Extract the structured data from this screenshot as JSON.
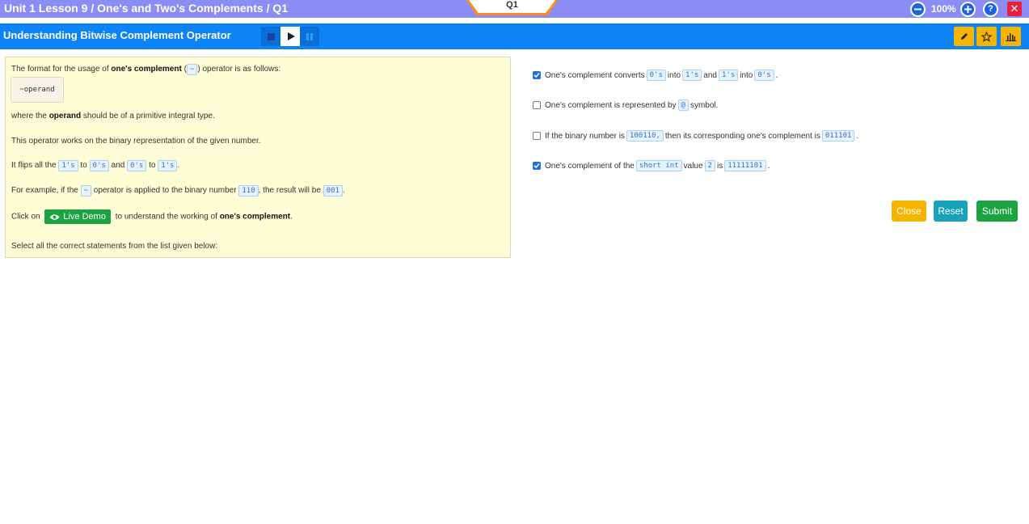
{
  "header": {
    "breadcrumb": "Unit 1 Lesson 9 / One's and Two's Complements / Q1",
    "question_tab": "Q1",
    "zoom": "100%",
    "zoom_out_icon": "minus-circle-icon",
    "zoom_in_icon": "plus-circle-icon",
    "help_icon": "question-circle-icon",
    "close_icon": "close-icon",
    "colors": {
      "header_bg": "#8c8cf5",
      "tab_accent": "#ff8c1a",
      "close_bg": "#e8223c"
    }
  },
  "toolbar": {
    "title": "Understanding Bitwise Complement Operator",
    "media_icons": [
      "stop-icon",
      "play-icon",
      "pause-icon"
    ],
    "tool_icons": [
      "pencil-icon",
      "star-icon",
      "bar-chart-icon"
    ],
    "colors": {
      "bar_bg": "#0d84f5",
      "tool_bg": "#f5b400"
    }
  },
  "lesson": {
    "l1_pre": "The format for the usage of ",
    "l1_bold": "one's complement",
    "l1_mid": " (",
    "l1_code": "~",
    "l1_post": ") operator is as follows:",
    "code_sample": "~operand",
    "l2_pre": "where the ",
    "l2_bold": "operand",
    "l2_post": " should be of a primitive integral type.",
    "l3": "This operator works on the binary representation of the given number.",
    "l4_a": "It flips all the ",
    "l4_c1": "1's",
    "l4_b": " to ",
    "l4_c2": "0's",
    "l4_c": " and ",
    "l4_c3": "0's",
    "l4_d": " to ",
    "l4_c4": "1's",
    "l4_e": ".",
    "l5_a": "For example, if the ",
    "l5_c1": "~",
    "l5_b": " operator is applied to the binary number ",
    "l5_c2": "110",
    "l5_c": ", the result will be ",
    "l5_c3": "001",
    "l5_d": ".",
    "l6_a": "Click on ",
    "live_demo": "Live Demo",
    "live_demo_icon": "eye-icon",
    "l6_b": " to understand the working of ",
    "l6_bold": "one's complement",
    "l6_c": ".",
    "l7": "Select all the correct statements from the list given below:"
  },
  "options": [
    {
      "checked": true,
      "t1": "One's complement converts ",
      "c1": "0's",
      "t2": " into ",
      "c2": "1's",
      "t3": " and ",
      "c3": "1's",
      "t4": " into ",
      "c4": "0's",
      "t5": "."
    },
    {
      "checked": false,
      "t1": "One's complement is represented by ",
      "c1": "@",
      "t2": " symbol."
    },
    {
      "checked": false,
      "t1": "If the binary number is ",
      "c1": "100110,",
      "t2": " then its corresponding one's complement is ",
      "c2": "011101",
      "t3": "."
    },
    {
      "checked": true,
      "t1": "One's complement of the ",
      "c1": "short int",
      "t2": " value ",
      "c2": "2",
      "t3": " is ",
      "c3": "11111101",
      "t4": "."
    }
  ],
  "actions": {
    "close": "Close",
    "reset": "Reset",
    "submit": "Submit",
    "colors": {
      "close": "#f5b400",
      "reset": "#17a2b8",
      "submit": "#1aa33f"
    }
  }
}
